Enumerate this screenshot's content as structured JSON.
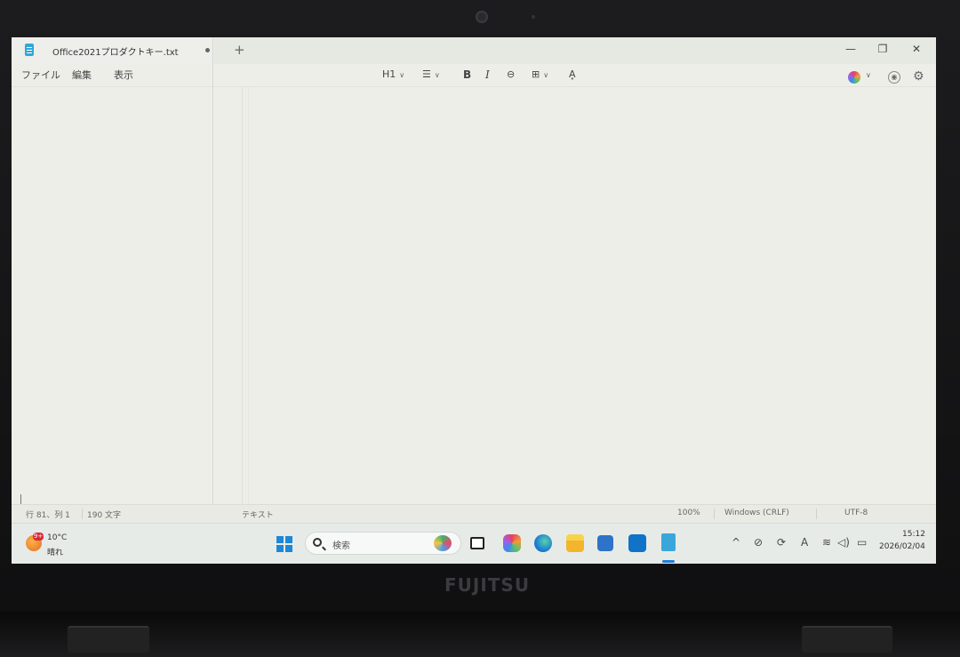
{
  "window": {
    "tab_title": "Office2021プロダクトキー.txt",
    "new_tab_label": "+",
    "minimize": "—",
    "maximize": "❐",
    "close": "✕"
  },
  "menu": {
    "file": "ファイル",
    "edit": "編集",
    "view": "表示"
  },
  "toolbar": {
    "heading": "H1",
    "list": "☰",
    "bold": "B",
    "italic": "I",
    "link": "⊖",
    "table": "⊞",
    "format_clear": "A͓"
  },
  "statusbar": {
    "position": "行 81、列 1",
    "char_count": "190 文字",
    "mode": "テキスト",
    "zoom": "100%",
    "line_ending": "Windows (CRLF)",
    "encoding": "UTF-8"
  },
  "taskbar": {
    "weather_badge": "9+",
    "weather_temp": "10°C",
    "weather_condition": "晴れ",
    "search_placeholder": "検索",
    "time": "15:12",
    "date": "2026/02/04",
    "tray_chevron": "^",
    "tray_font": "A"
  },
  "device": {
    "brand": "FUJITSU"
  },
  "colors": {
    "accent": "#1f7fd6",
    "notepad_icon": "#2fa8d8"
  }
}
